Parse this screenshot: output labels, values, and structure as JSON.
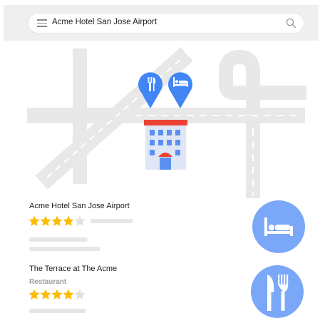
{
  "search": {
    "query": "Acme Hotel San Jose Airport"
  },
  "icons": {
    "menu": "hamburger-menu-icon",
    "search": "magnifier-icon",
    "restaurant_pin": "restaurant-pin-icon",
    "hotel_pin": "hotel-pin-icon",
    "hotel_building": "hotel-building-icon",
    "bed": "bed-icon",
    "utensils": "fork-knife-icon"
  },
  "listings": [
    {
      "name": "Acme Hotel San Jose Airport",
      "category": "",
      "rating": 4
    },
    {
      "name": "The Terrace at The Acme",
      "category": "Restaurant",
      "rating": 4
    }
  ],
  "colors": {
    "accent": "#4285f4",
    "button": "#7aa7f8",
    "star": "#fbbc04",
    "road": "#e8e8e8",
    "roof": "#ea4335"
  }
}
